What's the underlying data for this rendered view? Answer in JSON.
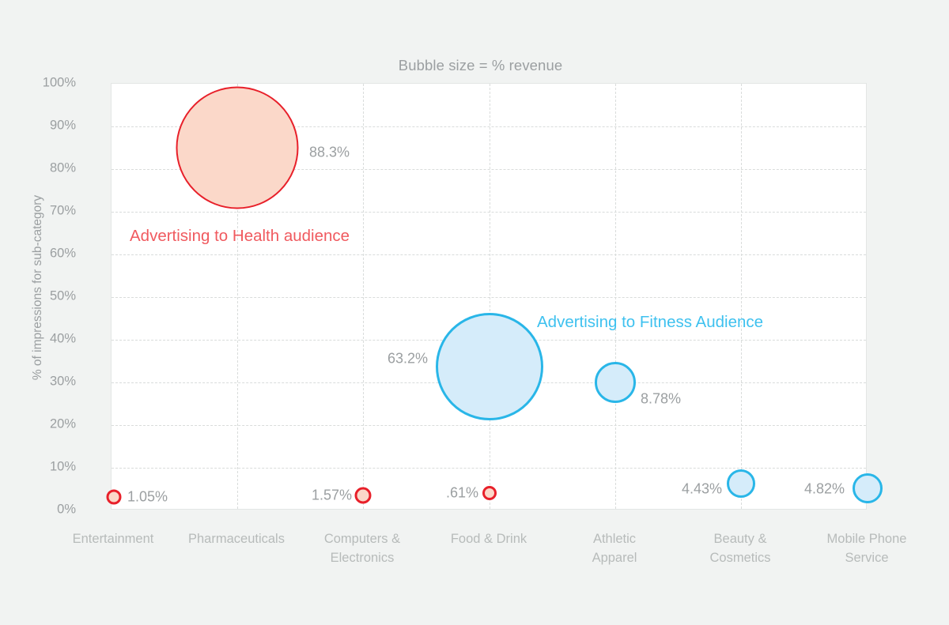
{
  "chart_data": {
    "type": "scatter",
    "title": "Bubble size = % revenue",
    "xlabel": "",
    "ylabel": "% of impressions for sub-category",
    "ylim": [
      0,
      100
    ],
    "grid": true,
    "legend": "none",
    "categories": [
      "Entertainment",
      "Pharmaceuticals",
      "Computers & Electronics",
      "Food & Drink",
      "Athletic Apparel",
      "Beauty & Cosmetics",
      "Mobile Phone Service"
    ],
    "ytick_labels": [
      "0%",
      "10%",
      "20%",
      "30%",
      "40%",
      "50%",
      "60%",
      "70%",
      "80%",
      "90%",
      "100%"
    ],
    "ytick_values": [
      0,
      10,
      20,
      30,
      40,
      50,
      60,
      70,
      80,
      90,
      100
    ],
    "points": [
      {
        "category": "Entertainment",
        "y": 2.4,
        "size_label": "1.05%",
        "size_value": 1.05,
        "color": "red",
        "label_side": "right"
      },
      {
        "category": "Pharmaceuticals",
        "y": 88.3,
        "size_label": "88.3%",
        "size_value": 88.3,
        "color": "red",
        "label_side": "right"
      },
      {
        "category": "Computers & Electronics",
        "y": 2.6,
        "size_label": "1.57%",
        "size_value": 1.57,
        "color": "red",
        "label_side": "left"
      },
      {
        "category": "Food & Drink",
        "y": 3.2,
        "size_label": ".61%",
        "size_value": 0.61,
        "color": "red",
        "label_side": "left"
      },
      {
        "category": "Food & Drink",
        "y": 33.8,
        "size_label": "63.2%",
        "size_value": 63.2,
        "color": "blue",
        "label_side": "left"
      },
      {
        "category": "Athletic Apparel",
        "y": 30.2,
        "size_label": "8.78%",
        "size_value": 8.78,
        "color": "blue",
        "label_side": "right"
      },
      {
        "category": "Beauty & Cosmetics",
        "y": 6.6,
        "size_label": "4.43%",
        "size_value": 4.43,
        "color": "blue",
        "label_side": "left"
      },
      {
        "category": "Mobile Phone Service",
        "y": 5.3,
        "size_label": "4.82%",
        "size_value": 4.82,
        "color": "blue",
        "label_side": "left"
      }
    ],
    "annotations": [
      {
        "text": "Advertising to Health audience",
        "color": "#f05a5f",
        "series": "red"
      },
      {
        "text": "Advertising to Fitness Audience",
        "color": "#3ec1ef",
        "series": "blue"
      }
    ]
  },
  "colors": {
    "red_stroke": "#e8202a",
    "red_fill": "#fbd8c9",
    "blue_stroke": "#29b6e8",
    "blue_fill": "#d5ecfa",
    "axis_text": "#9b9fa1",
    "xaxis_text": "#b7bbba",
    "background": "#f1f3f2",
    "plot_background": "#ffffff",
    "gridline": "#d9dcdb"
  },
  "yticks": {
    "t0": "0%",
    "t1": "10%",
    "t2": "20%",
    "t3": "30%",
    "t4": "40%",
    "t5": "50%",
    "t6": "60%",
    "t7": "70%",
    "t8": "80%",
    "t9": "90%",
    "t10": "100%"
  },
  "xticks": {
    "c0_line1": "Entertainment",
    "c0_line2": "",
    "c1_line1": "Pharmaceuticals",
    "c1_line2": "",
    "c2_line1": "Computers &",
    "c2_line2": "Electronics",
    "c3_line1": "Food & Drink",
    "c3_line2": "",
    "c4_line1": "Athletic",
    "c4_line2": "Apparel",
    "c5_line1": "Beauty &",
    "c5_line2": "Cosmetics",
    "c6_line1": "Mobile Phone",
    "c6_line2": "Service"
  },
  "labels": {
    "entertainment": "1.05%",
    "pharmaceuticals": "88.3%",
    "computers": "1.57%",
    "food_small": ".61%",
    "food_big": "63.2%",
    "athletic": "8.78%",
    "beauty": "4.43%",
    "mobile": "4.82%"
  },
  "annotations": {
    "health": "Advertising to Health audience",
    "fitness": "Advertising to Fitness Audience"
  }
}
